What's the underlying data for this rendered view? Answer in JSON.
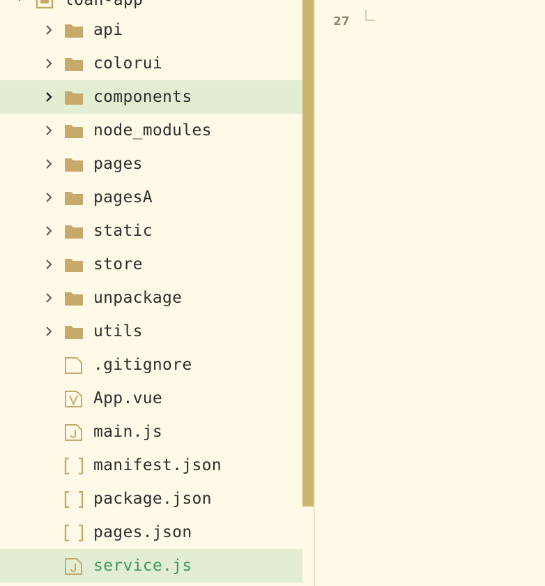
{
  "explorer": {
    "root": {
      "label": "loan-app",
      "icon": "project-folder-icon"
    },
    "items": [
      {
        "label": "api",
        "type": "folder",
        "icon": "folder-icon"
      },
      {
        "label": "colorui",
        "type": "folder",
        "icon": "folder-icon"
      },
      {
        "label": "components",
        "type": "folder",
        "icon": "folder-icon",
        "state": "hovered"
      },
      {
        "label": "node_modules",
        "type": "folder",
        "icon": "folder-icon"
      },
      {
        "label": "pages",
        "type": "folder",
        "icon": "folder-icon"
      },
      {
        "label": "pagesA",
        "type": "folder",
        "icon": "folder-icon"
      },
      {
        "label": "static",
        "type": "folder",
        "icon": "folder-icon"
      },
      {
        "label": "store",
        "type": "folder",
        "icon": "folder-icon"
      },
      {
        "label": "unpackage",
        "type": "folder",
        "icon": "folder-icon"
      },
      {
        "label": "utils",
        "type": "folder",
        "icon": "folder-icon"
      },
      {
        "label": ".gitignore",
        "type": "file",
        "icon": "blank-file-icon"
      },
      {
        "label": "App.vue",
        "type": "file",
        "icon": "vue-file-icon"
      },
      {
        "label": "main.js",
        "type": "file",
        "icon": "js-file-icon"
      },
      {
        "label": "manifest.json",
        "type": "file",
        "icon": "json-file-icon"
      },
      {
        "label": "package.json",
        "type": "file",
        "icon": "json-file-icon"
      },
      {
        "label": "pages.json",
        "type": "file",
        "icon": "json-file-icon"
      },
      {
        "label": "service.js",
        "type": "file",
        "icon": "js-file-icon",
        "state": "selected"
      }
    ]
  },
  "editor": {
    "line_number": "27"
  },
  "colors": {
    "background": "#fffae8",
    "selection": "#e2edd2",
    "scrollbar": "#cdb46e",
    "folder": "#c7a96b",
    "active_file_text": "#3d9a5a"
  }
}
